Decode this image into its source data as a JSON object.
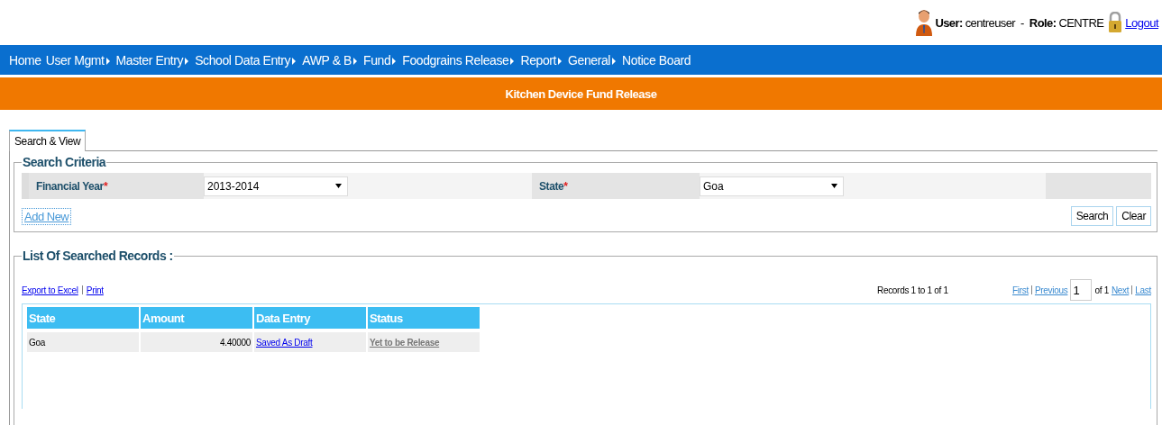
{
  "user_bar": {
    "user_label": "User:",
    "user": "centreuser",
    "separator": "-",
    "role_label": "Role:",
    "role": "CENTRE",
    "logout": "Logout"
  },
  "menu": [
    {
      "label": "Home",
      "has_submenu": false
    },
    {
      "label": "User Mgmt",
      "has_submenu": true
    },
    {
      "label": "Master Entry",
      "has_submenu": true
    },
    {
      "label": "School Data Entry",
      "has_submenu": true
    },
    {
      "label": "AWP & B",
      "has_submenu": true
    },
    {
      "label": "Fund",
      "has_submenu": true
    },
    {
      "label": "Foodgrains Release",
      "has_submenu": true
    },
    {
      "label": "Report",
      "has_submenu": true
    },
    {
      "label": "General",
      "has_submenu": true
    },
    {
      "label": "Notice Board",
      "has_submenu": false
    }
  ],
  "page_title": "Kitchen Device Fund Release",
  "tabs": [
    {
      "label": "Search & View",
      "selected": true
    }
  ],
  "search_criteria": {
    "legend": "Search Criteria",
    "fields": [
      {
        "label": "Financial Year",
        "required_mark": "*",
        "value": "2013-2014"
      },
      {
        "label": "State",
        "required_mark": "*",
        "value": "Goa"
      }
    ],
    "add_new": "Add New",
    "buttons": [
      "Search",
      "Clear"
    ]
  },
  "records": {
    "legend": "List Of Searched Records :",
    "export": "Export to Excel",
    "print": "Print",
    "summary": "Records 1 to 1 of 1",
    "pager": {
      "first": "First",
      "previous": "Previous",
      "page": "1",
      "of": "of 1",
      "next": "Next",
      "last": "Last"
    },
    "table": {
      "columns": [
        "State",
        "Amount",
        "Data Entry",
        "Status"
      ],
      "rows": [
        {
          "state": "Goa",
          "amount": "4.40000",
          "data_entry": "Saved As Draft",
          "status": "Yet to be Release"
        }
      ]
    }
  }
}
